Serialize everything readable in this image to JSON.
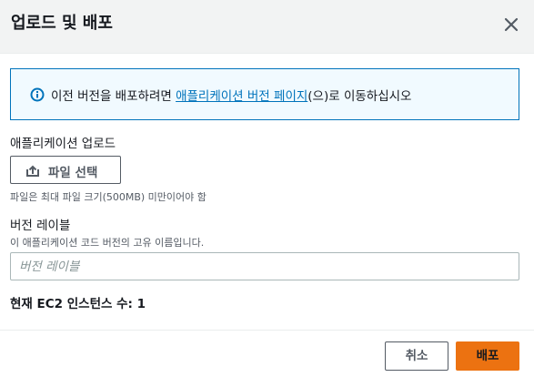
{
  "modal": {
    "title": "업로드 및 배포",
    "close_icon": "close-icon"
  },
  "info": {
    "icon": "info-icon",
    "text_before": "이전 버전을 배포하려면 ",
    "link_text": "애플리케이션 버전 페이지",
    "text_after": "(으)로 이동하십시오"
  },
  "upload": {
    "label": "애플리케이션 업로드",
    "button_icon": "upload-icon",
    "button_label": "파일 선택",
    "constraint": "파일은 최대 파일 크기(500MB) 미만이어야 함"
  },
  "version_label": {
    "label": "버전 레이블",
    "description": "이 애플리케이션 코드 버전의 고유 이름입니다.",
    "placeholder": "버전 레이블",
    "value": ""
  },
  "instances": {
    "text": "현재 EC2 인스턴스 수: 1"
  },
  "footer": {
    "cancel_label": "취소",
    "deploy_label": "배포"
  },
  "colors": {
    "accent": "#0073bb",
    "primary_button": "#ec7211",
    "header_bg": "#f2f3f3",
    "info_bg": "#f1faff"
  }
}
